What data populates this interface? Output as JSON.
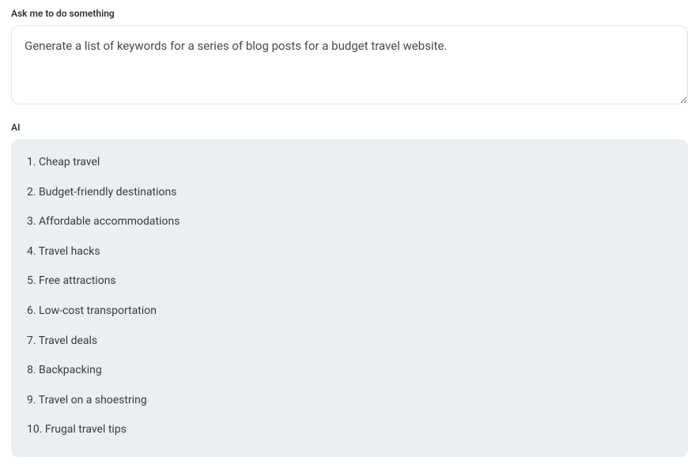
{
  "prompt": {
    "label": "Ask me to do something",
    "value": "Generate a list of keywords for a series of blog posts for a budget travel website."
  },
  "response": {
    "label": "AI",
    "items": [
      "Cheap travel",
      "Budget-friendly destinations",
      "Affordable accommodations",
      "Travel hacks",
      "Free attractions",
      "Low-cost transportation",
      "Travel deals",
      "Backpacking",
      "Travel on a shoestring",
      "Frugal travel tips"
    ]
  }
}
